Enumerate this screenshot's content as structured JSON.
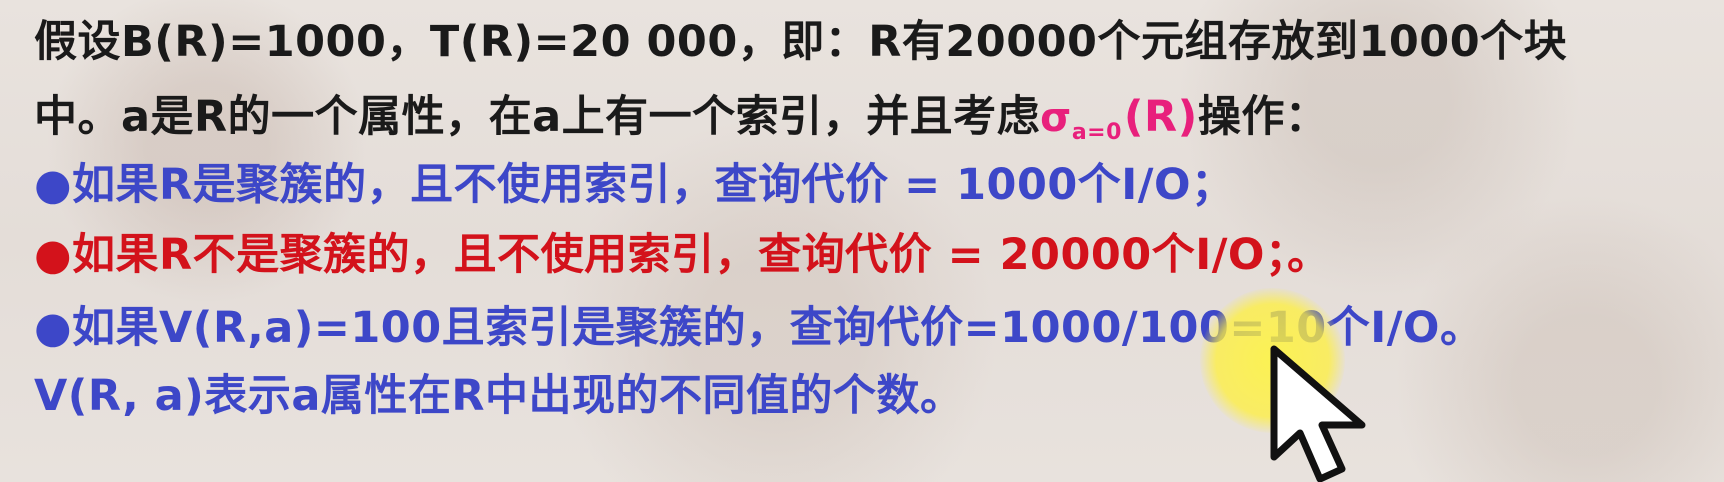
{
  "slide": {
    "line1": "假设B(R)=1000，T(R)=20  000，即：R有20000个元组存放到1000个块",
    "line2_a": "中。a是R的一个属性，在a上有一个索引，并且考虑",
    "line2_sigma": "σ",
    "line2_subscript": "a=0",
    "line2_sigma_arg": "(R)",
    "line2_b": "操作：",
    "line3": "●如果R是聚簇的，且不使用索引，查询代价 = 1000个I/O；",
    "line4": "●如果R不是聚簇的，且不使用索引，查询代价 = 20000个I/O；。",
    "line5": "●如果V(R,a)=100且索引是聚簇的，查询代价=1000/100=10个I/O。",
    "line6": "V(R, a)表示a属性在R中出现的不同值的个数。"
  },
  "colors": {
    "text_black": "#1a1a1a",
    "text_blue": "#3d47c8",
    "text_red": "#d3121b",
    "sigma_pink": "#e8207c",
    "cursor_highlight": "#fff23c"
  },
  "icons": {
    "cursor": "mouse-pointer-icon"
  }
}
